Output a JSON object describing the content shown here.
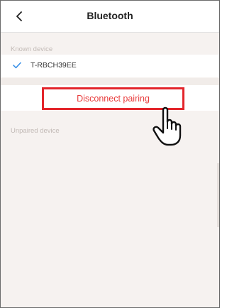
{
  "header": {
    "title": "Bluetooth",
    "back_icon": "chevron-left-icon"
  },
  "known_section": {
    "label": "Known device",
    "devices": [
      {
        "name": "T-RBCH39EE",
        "status_icon": "check-icon",
        "accent": "#2f8be6"
      }
    ]
  },
  "actions": {
    "disconnect_label": "Disconnect pairing",
    "disconnect_color": "#e83a3a",
    "highlight_color": "#e3252b"
  },
  "unpaired_section": {
    "label": "Unpaired device"
  },
  "overlay": {
    "pointer_icon": "pointing-hand-icon"
  }
}
